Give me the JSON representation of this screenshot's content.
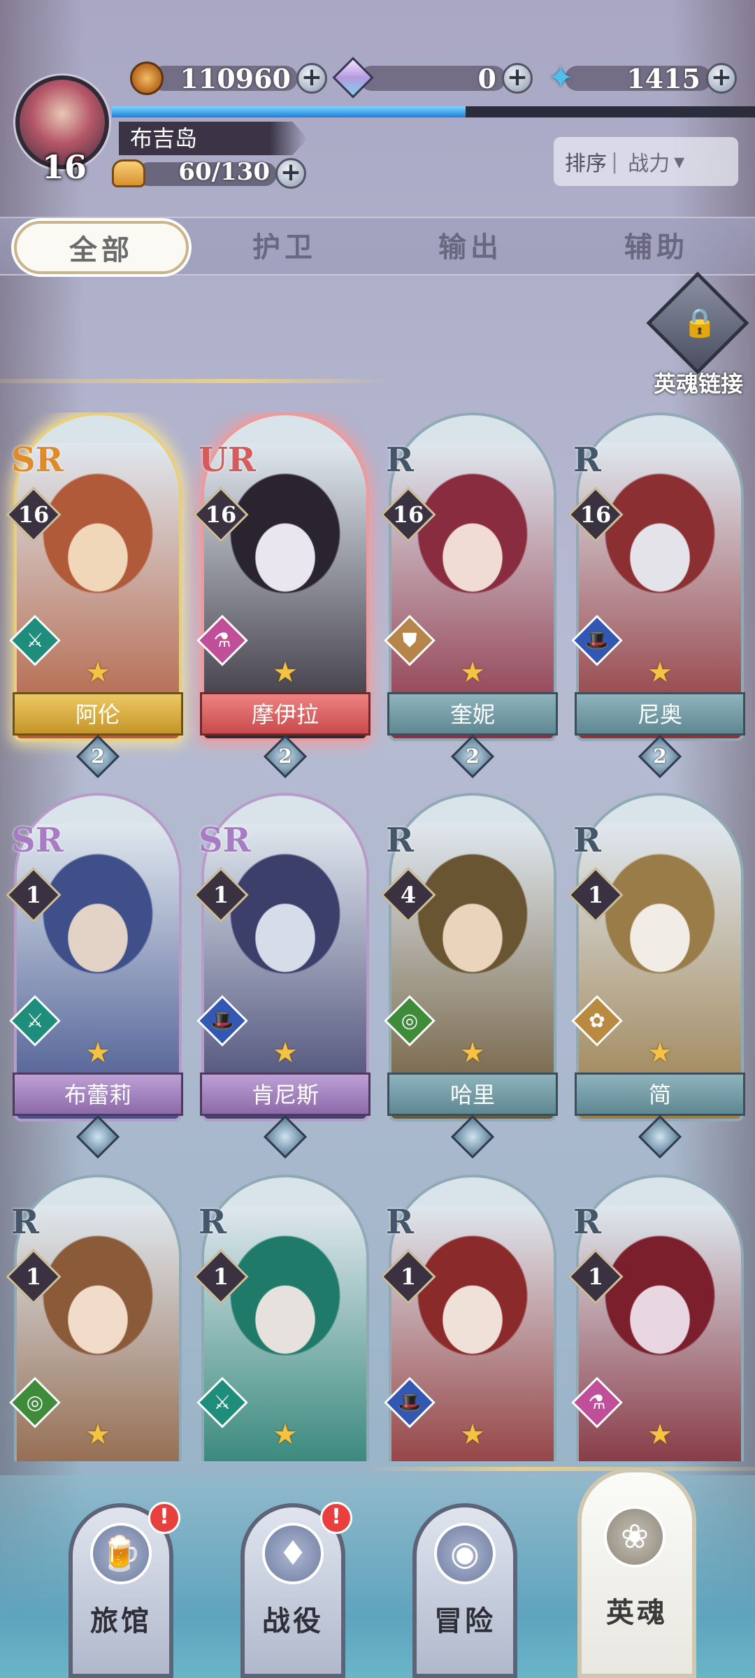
{
  "player": {
    "level": "16",
    "location": "布吉岛",
    "xp_fraction": 0.55
  },
  "resources": {
    "gold": "110960",
    "gems": "0",
    "stars": "1415",
    "stamina": "60/130"
  },
  "sort": {
    "label": "排序",
    "value": "战力"
  },
  "tabs": [
    {
      "label": "全部",
      "active": true
    },
    {
      "label": "护卫",
      "active": false
    },
    {
      "label": "输出",
      "active": false
    },
    {
      "label": "辅助",
      "active": false
    }
  ],
  "soul_link": {
    "label": "英魂链接"
  },
  "heroes": [
    {
      "name": "阿伦",
      "rarity": "SR",
      "level": "16",
      "stars": "2",
      "class_icon": "crossbow-icon",
      "class_color": "#1f8d7c",
      "tier": "ssr",
      "palette": [
        "#b05a3a",
        "#f0d7b9"
      ]
    },
    {
      "name": "摩伊拉",
      "rarity": "UR",
      "level": "16",
      "stars": "2",
      "class_icon": "potion-icon",
      "class_color": "#c04f9a",
      "tier": "ur",
      "palette": [
        "#2a2430",
        "#e9e6ef"
      ]
    },
    {
      "name": "奎妮",
      "rarity": "R",
      "level": "16",
      "stars": "2",
      "class_icon": "shield-icon",
      "class_color": "#b7854a",
      "tier": "r",
      "palette": [
        "#8a2c3f",
        "#f0dcd3"
      ]
    },
    {
      "name": "尼奥",
      "rarity": "R",
      "level": "16",
      "stars": "2",
      "class_icon": "hat-icon",
      "class_color": "#3358b3",
      "tier": "r",
      "palette": [
        "#8c2f33",
        "#e5e3ea"
      ]
    },
    {
      "name": "布蕾莉",
      "rarity": "SR",
      "level": "1",
      "stars": "",
      "class_icon": "crossbow-icon",
      "class_color": "#1f8d7c",
      "tier": "sr",
      "palette": [
        "#3f4f8a",
        "#e2d3c6"
      ]
    },
    {
      "name": "肯尼斯",
      "rarity": "SR",
      "level": "1",
      "stars": "",
      "class_icon": "hat-icon",
      "class_color": "#3358b3",
      "tier": "sr",
      "palette": [
        "#3d3f6b",
        "#d7dde8"
      ]
    },
    {
      "name": "哈里",
      "rarity": "R",
      "level": "4",
      "stars": "",
      "class_icon": "target-icon",
      "class_color": "#3e8b3a",
      "tier": "r",
      "palette": [
        "#6a5533",
        "#ead4bb"
      ]
    },
    {
      "name": "简",
      "rarity": "R",
      "level": "1",
      "stars": "",
      "class_icon": "rose-icon",
      "class_color": "#b98a3f",
      "tier": "r",
      "palette": [
        "#9a7c49",
        "#f2ece6"
      ]
    },
    {
      "name": "",
      "rarity": "R",
      "level": "1",
      "stars": "",
      "class_icon": "target-icon",
      "class_color": "#3e8b3a",
      "tier": "r",
      "palette": [
        "#8a5a39",
        "#f1dcc9"
      ]
    },
    {
      "name": "",
      "rarity": "R",
      "level": "1",
      "stars": "",
      "class_icon": "crossbow-icon",
      "class_color": "#1f8d7c",
      "tier": "r",
      "palette": [
        "#1f7a6a",
        "#e6e1dc"
      ]
    },
    {
      "name": "",
      "rarity": "R",
      "level": "1",
      "stars": "",
      "class_icon": "hat-icon",
      "class_color": "#3358b3",
      "tier": "r",
      "palette": [
        "#8a2a2a",
        "#efe0d8"
      ]
    },
    {
      "name": "",
      "rarity": "R",
      "level": "1",
      "stars": "",
      "class_icon": "potion-icon",
      "class_color": "#c04f9a",
      "tier": "r",
      "palette": [
        "#7a1f2b",
        "#e8d7e1"
      ]
    }
  ],
  "bottom_nav": [
    {
      "label": "旅馆",
      "icon": "beer-icon",
      "badge": "!",
      "active": false
    },
    {
      "label": "战役",
      "icon": "battle-card-icon",
      "badge": "!",
      "active": false
    },
    {
      "label": "冒险",
      "icon": "compass-icon",
      "badge": "",
      "active": false
    },
    {
      "label": "英魂",
      "icon": "rose-emblem-icon",
      "badge": "",
      "active": true
    }
  ]
}
